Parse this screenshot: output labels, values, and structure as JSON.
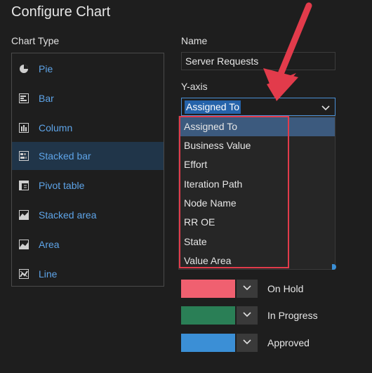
{
  "dialog": {
    "title": "Configure Chart"
  },
  "chart_type": {
    "label": "Chart Type",
    "items": [
      {
        "label": "Pie",
        "icon": "pie-chart-icon"
      },
      {
        "label": "Bar",
        "icon": "bar-chart-icon"
      },
      {
        "label": "Column",
        "icon": "column-chart-icon"
      },
      {
        "label": "Stacked bar",
        "icon": "stacked-bar-icon",
        "selected": true
      },
      {
        "label": "Pivot table",
        "icon": "pivot-table-icon"
      },
      {
        "label": "Stacked area",
        "icon": "stacked-area-icon"
      },
      {
        "label": "Area",
        "icon": "area-chart-icon"
      },
      {
        "label": "Line",
        "icon": "line-chart-icon"
      }
    ]
  },
  "name": {
    "label": "Name",
    "value": "Server Requests"
  },
  "yaxis": {
    "label": "Y-axis",
    "selected": "Assigned To",
    "options": [
      "Assigned To",
      "Business Value",
      "Effort",
      "Iteration Path",
      "Node Name",
      "RR OE",
      "State",
      "Value Area"
    ]
  },
  "series_colors": [
    {
      "label": "On Hold",
      "color": "#f06070"
    },
    {
      "label": "In Progress",
      "color": "#2a7f56"
    },
    {
      "label": "Approved",
      "color": "#3b8fd6"
    }
  ],
  "annotation": {
    "arrow_color": "#e23b4b",
    "box_color": "#e23b4b"
  }
}
